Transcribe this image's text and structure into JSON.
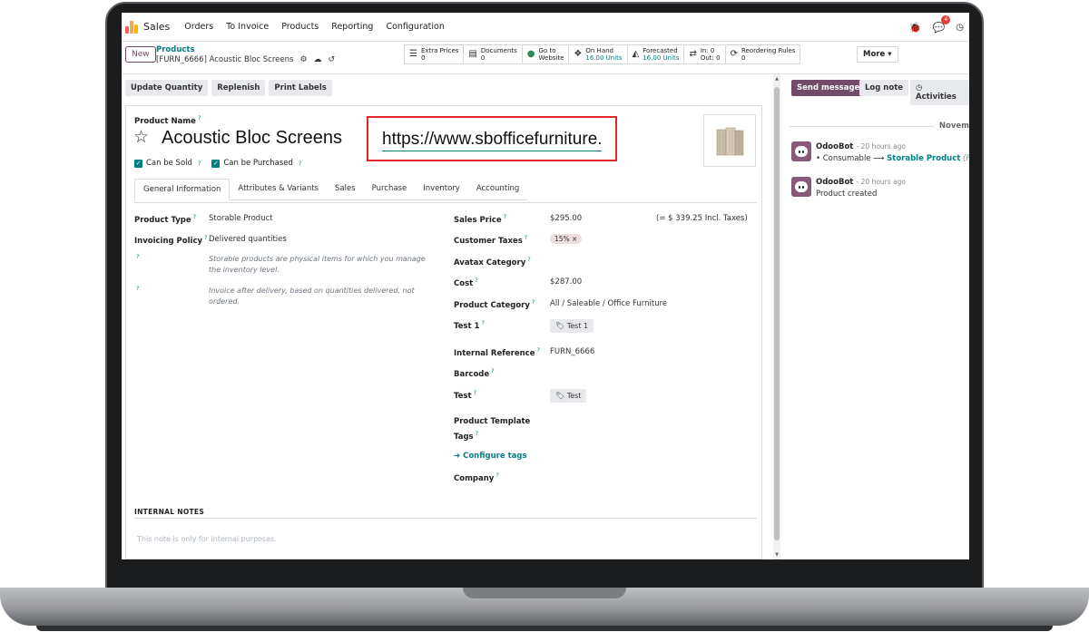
{
  "nav": {
    "app_name": "Sales",
    "menu": [
      "Orders",
      "To Invoice",
      "Products",
      "Reporting",
      "Configuration"
    ],
    "chat_count": "4"
  },
  "control": {
    "new_label": "New",
    "breadcrumb": "Products",
    "record_title": "[FURN_6666] Acoustic Bloc Screens",
    "stats": [
      {
        "label": "Extra Prices",
        "value": "0",
        "icon": "list-icon"
      },
      {
        "label": "Documents",
        "value": "0",
        "icon": "documents-icon"
      },
      {
        "label": "Go to",
        "value": "Website",
        "icon": "globe-icon"
      },
      {
        "label": "On Hand",
        "value": "16.00 Units",
        "icon": "cubes-icon"
      },
      {
        "label": "Forecasted",
        "value": "16.00 Units",
        "icon": "area-chart-icon"
      },
      {
        "label": "In: 0",
        "value": "Out: 0",
        "icon": "exchange-icon"
      },
      {
        "label": "Reordering Rules",
        "value": "0",
        "icon": "refresh-icon"
      }
    ],
    "more_label": "More"
  },
  "buttons": [
    "Update Quantity",
    "Replenish",
    "Print Labels"
  ],
  "form": {
    "product_name_label": "Product Name",
    "product_name": "Acoustic Bloc Screens",
    "url": "https://www.sbofficefurniture.com/acoustic-bloc-screens",
    "can_be_sold": "Can be Sold",
    "can_be_purchased": "Can be Purchased",
    "tabs": [
      "General Information",
      "Attributes & Variants",
      "Sales",
      "Purchase",
      "Inventory",
      "Accounting"
    ],
    "left": {
      "product_type_label": "Product Type",
      "product_type": "Storable Product",
      "invoicing_policy_label": "Invoicing Policy",
      "invoicing_policy": "Delivered quantities",
      "help1": "Storable products are physical items for which you manage the inventory level.",
      "help2": "Invoice after delivery, based on quantities delivered, not ordered."
    },
    "right": {
      "sales_price_label": "Sales Price",
      "sales_price": "$295.00",
      "incl_taxes": "(= $ 339.25 Incl. Taxes)",
      "customer_taxes_label": "Customer Taxes",
      "customer_tax_tag": "15% ×",
      "avatax_label": "Avatax Category",
      "cost_label": "Cost",
      "cost": "$287.00",
      "category_label": "Product Category",
      "category": "All / Saleable / Office Furniture",
      "test1_label": "Test 1",
      "test1_tag": "Test 1",
      "internal_ref_label": "Internal Reference",
      "internal_ref": "FURN_6666",
      "barcode_label": "Barcode",
      "test_label": "Test",
      "test_tag": "Test",
      "template_tags_label_1": "Product Template",
      "template_tags_label_2": "Tags",
      "configure_tags": "Configure tags",
      "company_label": "Company"
    },
    "internal_notes_label": "INTERNAL NOTES",
    "internal_notes_placeholder": "This note is only for internal purposes."
  },
  "chatter": {
    "send_message": "Send message",
    "log_note": "Log note",
    "activities": "Activities",
    "date_separator": "Novem",
    "messages": [
      {
        "author": "OdooBot",
        "time": "- 20 hours ago",
        "from": "Consumable",
        "arrow": "⟶",
        "to": "Storable Product",
        "suffix": "(P"
      },
      {
        "author": "OdooBot",
        "time": "- 20 hours ago",
        "body": "Product created"
      }
    ]
  },
  "colors": {
    "brand": "#714b67",
    "accent": "#017e84",
    "highlight_box": "#e0252b"
  }
}
